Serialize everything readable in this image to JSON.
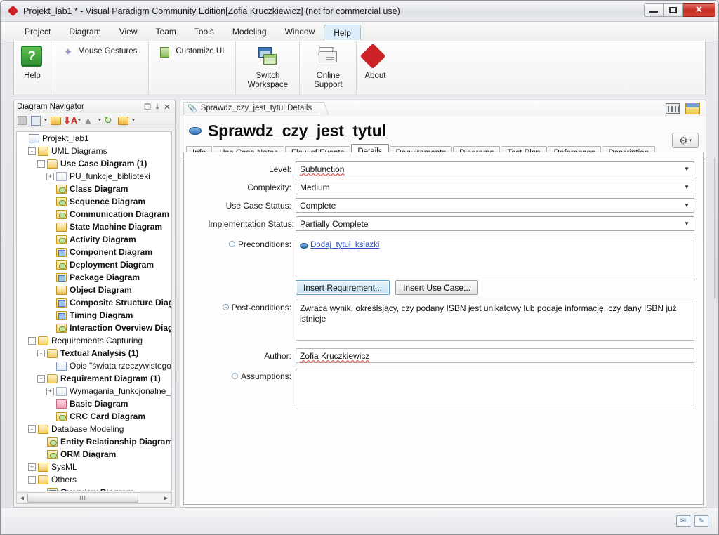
{
  "window": {
    "title": "Projekt_lab1 * - Visual Paradigm Community Edition[Zofia Kruczkiewicz] (not for commercial use)",
    "app_icon": "diamond-logo-icon",
    "minimize": "minimize-button",
    "maximize": "maximize-button",
    "close": "close-button"
  },
  "menubar": {
    "items": [
      {
        "label": "Project",
        "active": false
      },
      {
        "label": "Diagram",
        "active": false
      },
      {
        "label": "View",
        "active": false
      },
      {
        "label": "Team",
        "active": false
      },
      {
        "label": "Tools",
        "active": false
      },
      {
        "label": "Modeling",
        "active": false
      },
      {
        "label": "Window",
        "active": false
      },
      {
        "label": "Help",
        "active": true
      }
    ]
  },
  "ribbon": {
    "groups": [
      {
        "buttons": [
          {
            "label": "Help",
            "icon": "help-question-icon",
            "style": "large"
          }
        ]
      },
      {
        "buttons": [
          {
            "label": "Mouse Gestures",
            "icon": "mouse-gesture-icon",
            "style": "small"
          },
          {
            "label": "Customize UI",
            "icon": "customize-ui-icon",
            "style": "small"
          }
        ]
      },
      {
        "buttons": [
          {
            "label": "Switch Workspace",
            "icon": "switch-workspace-icon",
            "style": "large"
          }
        ]
      },
      {
        "buttons": [
          {
            "label": "Online Support",
            "icon": "online-support-mail-icon",
            "style": "large"
          }
        ]
      },
      {
        "buttons": [
          {
            "label": "About",
            "icon": "about-diamond-icon",
            "style": "large"
          }
        ]
      }
    ]
  },
  "navigator": {
    "title": "Diagram Navigator",
    "header_buttons": [
      {
        "name": "restore-panel-button",
        "glyph": "❐"
      },
      {
        "name": "pin-panel-button",
        "glyph": "⤓"
      },
      {
        "name": "close-panel-button",
        "glyph": "✕"
      }
    ],
    "toolbar": [
      {
        "name": "blank-icon",
        "type": "sq-grey"
      },
      {
        "name": "new-diagram-icon",
        "type": "sq-tree"
      },
      {
        "name": "dropdown-arrow-1",
        "type": "arrow"
      },
      {
        "name": "open-folder-icon",
        "type": "sq-fold"
      },
      {
        "name": "sort-icon",
        "type": "sort"
      },
      {
        "name": "dropdown-arrow-2",
        "type": "arrow"
      },
      {
        "name": "move-up-icon",
        "type": "up"
      },
      {
        "name": "dropdown-arrow-3",
        "type": "arrow"
      },
      {
        "name": "refresh-icon",
        "type": "refresh"
      },
      {
        "name": "folder-view-icon",
        "type": "sq-fold-y"
      },
      {
        "name": "dropdown-arrow-4",
        "type": "arrow"
      }
    ],
    "tree": [
      {
        "label": "Projekt_lab1",
        "depth": 0,
        "expander": "",
        "icon": "ic-proj",
        "bold": false
      },
      {
        "label": "UML Diagrams",
        "depth": 1,
        "expander": "-",
        "icon": "ic-fold-open",
        "bold": false
      },
      {
        "label": "Use Case Diagram (1)",
        "depth": 2,
        "expander": "-",
        "icon": "ic-fold-open",
        "bold": true
      },
      {
        "label": "PU_funkcje_biblioteki",
        "depth": 3,
        "expander": "+",
        "icon": "ic-pale",
        "bold": false
      },
      {
        "label": "Class Diagram",
        "depth": 3,
        "expander": "",
        "icon": "ic-uc",
        "bold": true
      },
      {
        "label": "Sequence Diagram",
        "depth": 3,
        "expander": "",
        "icon": "ic-uc",
        "bold": true
      },
      {
        "label": "Communication Diagram",
        "depth": 3,
        "expander": "",
        "icon": "ic-uc",
        "bold": true
      },
      {
        "label": "State Machine Diagram",
        "depth": 3,
        "expander": "",
        "icon": "ic-fold-d",
        "bold": true
      },
      {
        "label": "Activity Diagram",
        "depth": 3,
        "expander": "",
        "icon": "ic-uc",
        "bold": true
      },
      {
        "label": "Component Diagram",
        "depth": 3,
        "expander": "",
        "icon": "ic-yellow-blue",
        "bold": true
      },
      {
        "label": "Deployment Diagram",
        "depth": 3,
        "expander": "",
        "icon": "ic-uc",
        "bold": true
      },
      {
        "label": "Package Diagram",
        "depth": 3,
        "expander": "",
        "icon": "ic-yellow-blue",
        "bold": true
      },
      {
        "label": "Object Diagram",
        "depth": 3,
        "expander": "",
        "icon": "ic-fold-d",
        "bold": true
      },
      {
        "label": "Composite Structure Diagram",
        "depth": 3,
        "expander": "",
        "icon": "ic-yellow-blue",
        "bold": true
      },
      {
        "label": "Timing Diagram",
        "depth": 3,
        "expander": "",
        "icon": "ic-yellow-blue",
        "bold": true
      },
      {
        "label": "Interaction Overview Diagram",
        "depth": 3,
        "expander": "",
        "icon": "ic-uc",
        "bold": true
      },
      {
        "label": "Requirements Capturing",
        "depth": 1,
        "expander": "-",
        "icon": "ic-fold-open",
        "bold": false
      },
      {
        "label": "Textual Analysis (1)",
        "depth": 2,
        "expander": "-",
        "icon": "ic-fold-open",
        "bold": true
      },
      {
        "label": "Opis \"świata rzeczywistego\"",
        "depth": 3,
        "expander": "",
        "icon": "ic-doc",
        "bold": false
      },
      {
        "label": "Requirement Diagram (1)",
        "depth": 2,
        "expander": "-",
        "icon": "ic-fold-open",
        "bold": true
      },
      {
        "label": "Wymagania_funkcjonalne_i_n",
        "depth": 3,
        "expander": "+",
        "icon": "ic-pale",
        "bold": false
      },
      {
        "label": "Basic Diagram",
        "depth": 3,
        "expander": "",
        "icon": "ic-pink",
        "bold": true
      },
      {
        "label": "CRC Card Diagram",
        "depth": 3,
        "expander": "",
        "icon": "ic-uc",
        "bold": true
      },
      {
        "label": "Database Modeling",
        "depth": 1,
        "expander": "-",
        "icon": "ic-fold-open",
        "bold": false
      },
      {
        "label": "Entity Relationship Diagram",
        "depth": 2,
        "expander": "",
        "icon": "ic-uc",
        "bold": true
      },
      {
        "label": "ORM Diagram",
        "depth": 2,
        "expander": "",
        "icon": "ic-uc",
        "bold": true
      },
      {
        "label": "SysML",
        "depth": 1,
        "expander": "+",
        "icon": "ic-fold-d",
        "bold": false
      },
      {
        "label": "Others",
        "depth": 1,
        "expander": "-",
        "icon": "ic-fold-open",
        "bold": false
      },
      {
        "label": "Overview Diagram",
        "depth": 2,
        "expander": "",
        "icon": "ic-yellow-blue",
        "bold": true
      }
    ],
    "hscroll": {
      "left_arrow": "◄",
      "right_arrow": "►",
      "grip": "III"
    }
  },
  "main": {
    "breadcrumb": {
      "label": "Sprawdz_czy_jest_tytul Details",
      "icon": "paperclip-icon"
    },
    "header_icons": [
      {
        "name": "filmstrip-icon"
      },
      {
        "name": "window-layout-icon"
      }
    ],
    "use_case_title": "Sprawdz_czy_jest_tytul",
    "use_case_icon": "use-case-oval-icon",
    "gear_button": {
      "icon": "gear-icon",
      "caret": "▾"
    },
    "tabs": [
      {
        "label": "Info",
        "active": false
      },
      {
        "label": "Use Case Notes",
        "active": false
      },
      {
        "label": "Flow of Events",
        "active": false
      },
      {
        "label": "Details",
        "active": true
      },
      {
        "label": "Requirements",
        "active": false
      },
      {
        "label": "Diagrams",
        "active": false
      },
      {
        "label": "Test Plan",
        "active": false
      },
      {
        "label": "References",
        "active": false
      },
      {
        "label": "Description",
        "active": false
      }
    ],
    "details": {
      "level": {
        "label": "Level:",
        "value": "Subfunction"
      },
      "complexity": {
        "label": "Complexity:",
        "value": "Medium"
      },
      "use_case_status": {
        "label": "Use Case Status:",
        "value": "Complete"
      },
      "implementation_status": {
        "label": "Implementation Status:",
        "value": "Partially Complete"
      },
      "preconditions": {
        "label": "Preconditions:",
        "items": [
          {
            "text": "Dodaj_tytuł_ksiazki"
          }
        ]
      },
      "insert_requirement_button": "Insert Requirement...",
      "insert_use_case_button": "Insert Use Case...",
      "post_conditions": {
        "label": "Post-conditions:",
        "value": "Zwraca wynik, określsjący, czy podany ISBN jest unikatowy lub podaje informację, czy dany ISBN już istnieje"
      },
      "author": {
        "label": "Author:",
        "value": "Zofia Kruczkiewicz"
      },
      "assumptions": {
        "label": "Assumptions:",
        "value": ""
      }
    }
  },
  "statusbar": {
    "icons": [
      {
        "name": "mail-status-icon",
        "glyph": "✉"
      },
      {
        "name": "edit-note-status-icon",
        "glyph": "✎"
      }
    ]
  },
  "colors": {
    "accent_blue": "#2f6fb5",
    "link_blue": "#2f51c8",
    "brand_red": "#cc2127",
    "tab_active_bg": "#fdfdfd",
    "menu_active_bg": "#ddeefb"
  }
}
